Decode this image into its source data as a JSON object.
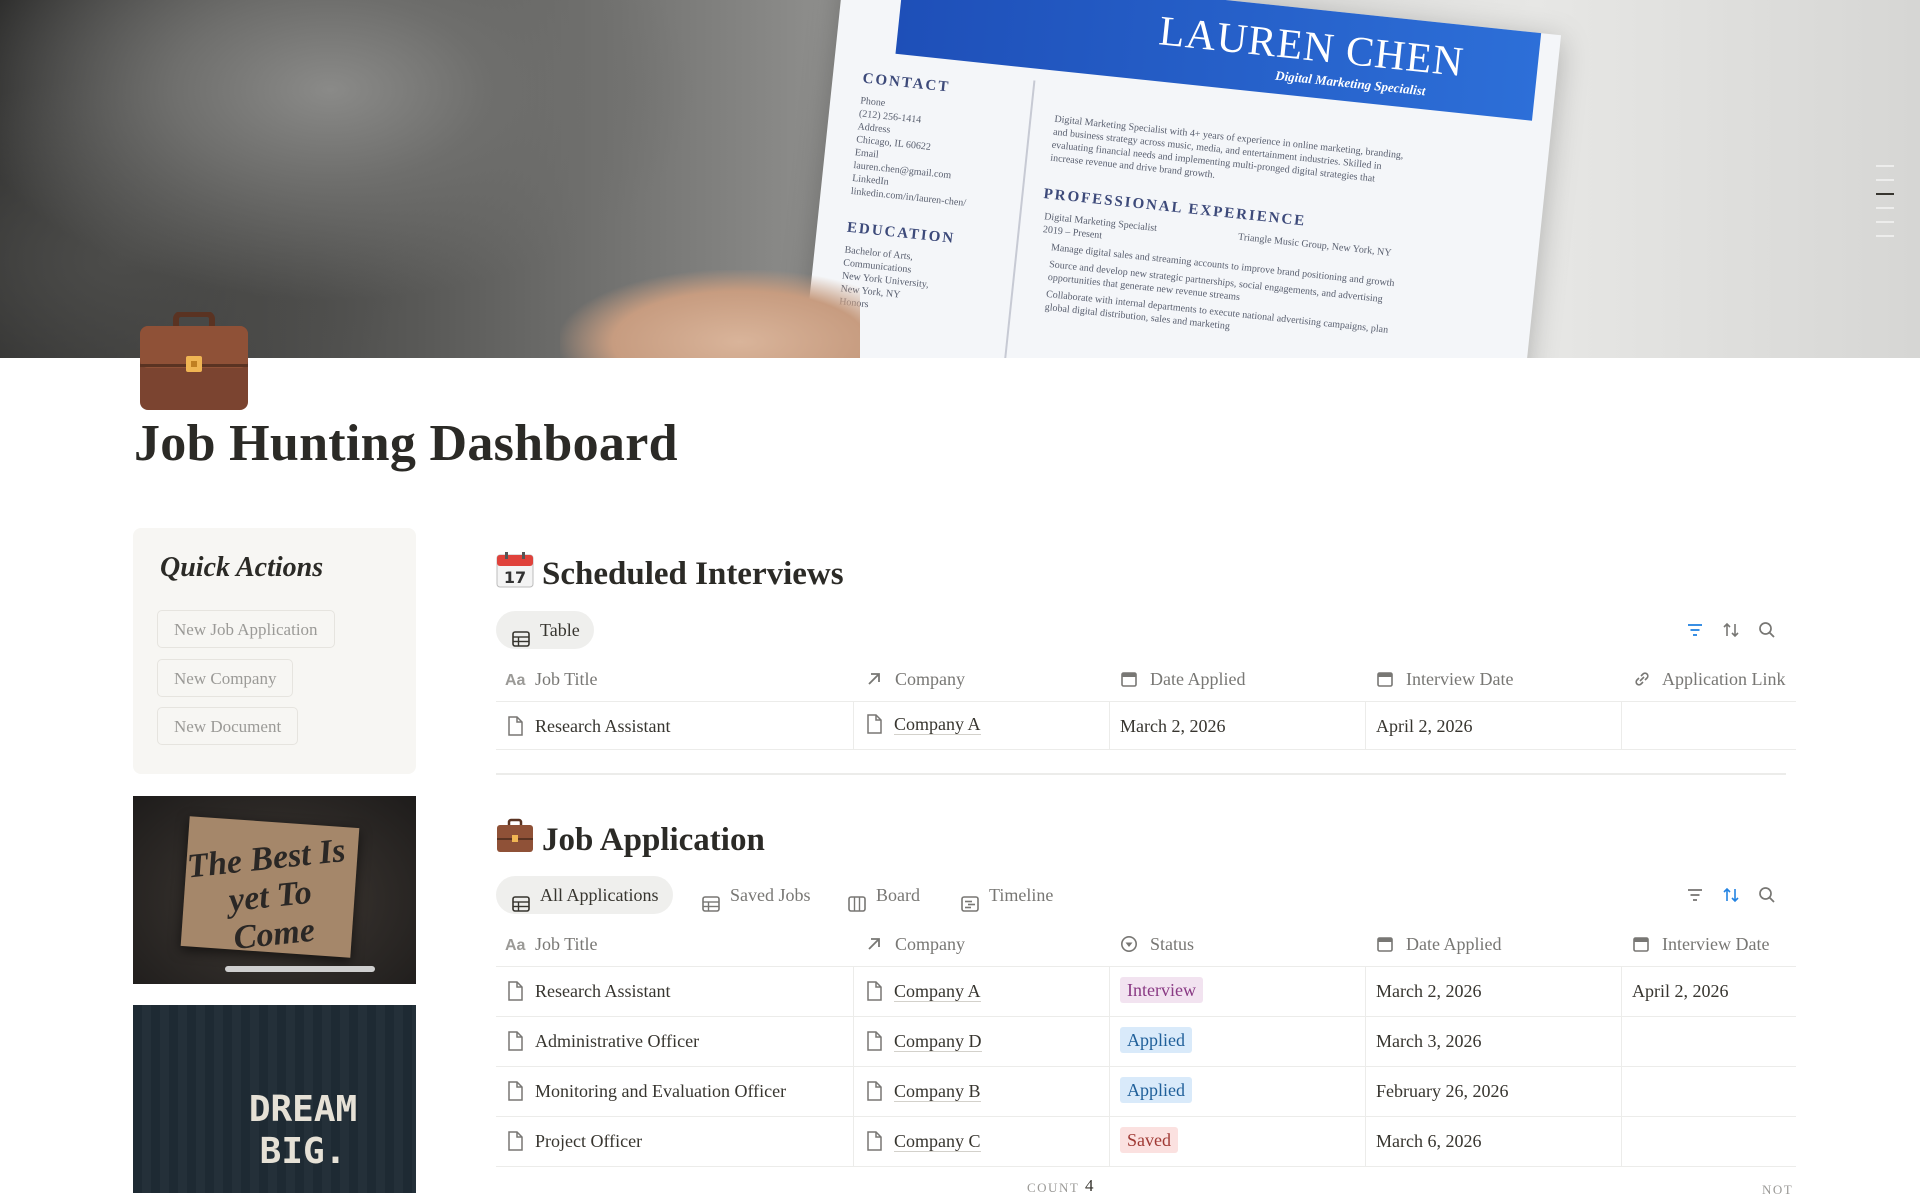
{
  "cover": {
    "resume_name": "LAUREN CHEN",
    "resume_role": "Digital Marketing Specialist",
    "resume_contact_heading": "CONTACT",
    "resume_contact_lines": [
      "Phone",
      "(212) 256-1414",
      "Address",
      "Chicago, IL 60622",
      "Email",
      "lauren.chen@gmail.com",
      "LinkedIn",
      "linkedin.com/in/lauren-chen/"
    ],
    "resume_education_heading": "EDUCATION",
    "resume_education_lines": [
      "Bachelor of Arts,",
      "Communications",
      "New York University,",
      "New York, NY",
      "Honors"
    ],
    "resume_summary": "Digital Marketing Specialist with 4+ years of experience in online marketing, branding, and business strategy across music, media, and entertainment industries. Skilled in evaluating financial needs and implementing multi-pronged digital strategies that increase revenue and drive brand growth.",
    "resume_experience_heading": "PROFESSIONAL EXPERIENCE",
    "resume_experience_role": "Digital Marketing Specialist",
    "resume_experience_dates": "2019 – Present",
    "resume_experience_company": "Triangle Music Group, New York, NY",
    "resume_bullets": [
      "Manage digital sales and streaming accounts to improve brand positioning and growth",
      "Source and develop new strategic partnerships, social engagements, and advertising opportunities that generate new revenue streams",
      "Collaborate with internal departments to execute national advertising campaigns, plan global digital distribution, sales and marketing"
    ]
  },
  "page": {
    "icon": "briefcase-icon",
    "title": "Job Hunting Dashboard"
  },
  "quick_actions": {
    "title": "Quick Actions",
    "buttons": [
      "New Job Application",
      "New Company",
      "New Document"
    ]
  },
  "images": {
    "motivation_1": "The Best Is yet To Come",
    "motivation_2": "DREAM BIG."
  },
  "interviews": {
    "icon": "calendar-icon",
    "title": "Scheduled Interviews",
    "tabs": [
      {
        "label": "Table",
        "icon": "table-icon",
        "active": true
      }
    ],
    "columns": [
      {
        "label": "Job Title",
        "icon": "text-property-icon"
      },
      {
        "label": "Company",
        "icon": "relation-arrow-icon"
      },
      {
        "label": "Date Applied",
        "icon": "calendar-property-icon"
      },
      {
        "label": "Interview Date",
        "icon": "calendar-property-icon"
      },
      {
        "label": "Application Link",
        "icon": "link-icon"
      }
    ],
    "rows": [
      {
        "job_title": "Research Assistant",
        "company": "Company A",
        "date_applied": "March 2, 2026",
        "interview_date": "April 2, 2026",
        "application_link": ""
      }
    ]
  },
  "applications": {
    "icon": "briefcase-icon",
    "title": "Job Application",
    "tabs": [
      {
        "label": "All Applications",
        "icon": "table-icon",
        "active": true
      },
      {
        "label": "Saved Jobs",
        "icon": "table-icon",
        "active": false
      },
      {
        "label": "Board",
        "icon": "board-icon",
        "active": false
      },
      {
        "label": "Timeline",
        "icon": "timeline-icon",
        "active": false
      }
    ],
    "columns": [
      {
        "label": "Job Title",
        "icon": "text-property-icon"
      },
      {
        "label": "Company",
        "icon": "relation-arrow-icon"
      },
      {
        "label": "Status",
        "icon": "status-icon"
      },
      {
        "label": "Date Applied",
        "icon": "calendar-property-icon"
      },
      {
        "label": "Interview Date",
        "icon": "calendar-property-icon"
      }
    ],
    "rows": [
      {
        "job_title": "Research Assistant",
        "company": "Company A",
        "status": "Interview",
        "date_applied": "March 2, 2026",
        "interview_date": "April 2, 2026"
      },
      {
        "job_title": "Administrative Officer",
        "company": "Company D",
        "status": "Applied",
        "date_applied": "March 3, 2026",
        "interview_date": ""
      },
      {
        "job_title": "Monitoring and Evaluation Officer",
        "company": "Company B",
        "status": "Applied",
        "date_applied": "February 26, 2026",
        "interview_date": ""
      },
      {
        "job_title": "Project Officer",
        "company": "Company C",
        "status": "Saved",
        "date_applied": "March 6, 2026",
        "interview_date": ""
      }
    ],
    "footer": {
      "count_label": "COUNT",
      "count_value": "4",
      "not_label": "NOT"
    }
  },
  "status_colors": {
    "Interview": {
      "bg": "#f2e3f0",
      "fg": "#8a3a84"
    },
    "Applied": {
      "bg": "#d9eafa",
      "fg": "#1f5f99"
    },
    "Saved": {
      "bg": "#fbe1e0",
      "fg": "#a03a35"
    }
  },
  "colors": {
    "accent_blue": "#2383e2",
    "text": "#37352f",
    "muted": "#787774"
  }
}
